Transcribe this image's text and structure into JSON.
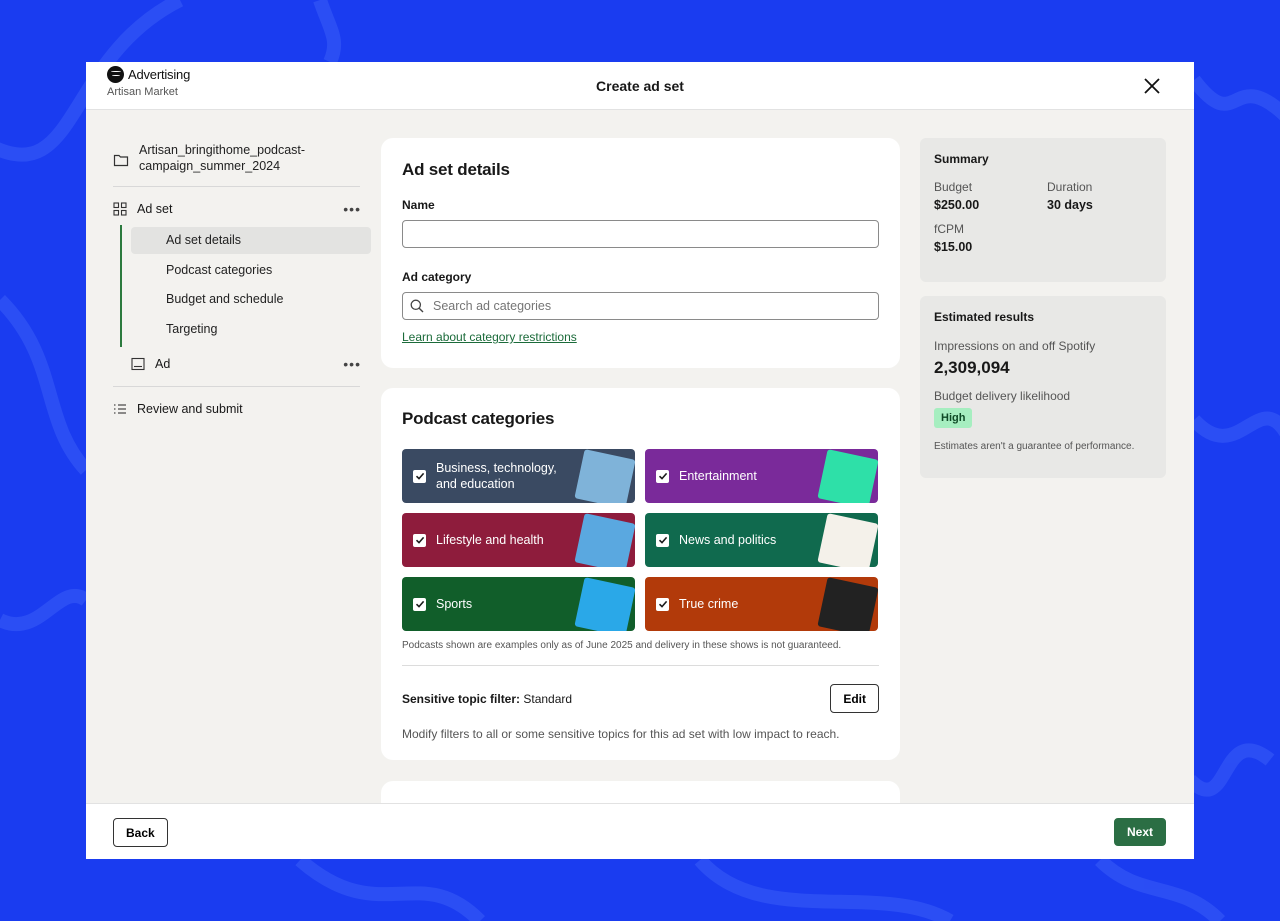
{
  "header": {
    "brand": "Advertising",
    "account": "Artisan Market",
    "title": "Create ad set"
  },
  "sidebar": {
    "campaign": "Artisan_bringithome_podcast-campaign_summer_2024",
    "adset_label": "Ad set",
    "adset_items": [
      "Ad set details",
      "Podcast categories",
      "Budget and schedule",
      "Targeting"
    ],
    "ad_label": "Ad",
    "review_label": "Review and submit"
  },
  "details": {
    "heading": "Ad set details",
    "name_label": "Name",
    "name_value": "",
    "category_label": "Ad category",
    "category_placeholder": "Search ad categories",
    "restrictions_link": "Learn about category restrictions"
  },
  "podcast": {
    "heading": "Podcast categories",
    "categories": [
      {
        "label": "Business, technology, and education",
        "checked": true,
        "color": "#3a4a62"
      },
      {
        "label": "Entertainment",
        "checked": true,
        "color": "#7a2a9a"
      },
      {
        "label": "Lifestyle and health",
        "checked": true,
        "color": "#8e1c3c"
      },
      {
        "label": "News and politics",
        "checked": true,
        "color": "#106a4e"
      },
      {
        "label": "Sports",
        "checked": true,
        "color": "#115e2a"
      },
      {
        "label": "True crime",
        "checked": true,
        "color": "#b23a0a"
      }
    ],
    "note": "Podcasts shown are examples only as of June 2025 and delivery in these shows is not guaranteed.",
    "sensitive_label": "Sensitive topic filter:",
    "sensitive_value": "Standard",
    "edit_label": "Edit",
    "sensitive_desc": "Modify filters to all or some sensitive topics for this ad set with low impact to reach."
  },
  "summary": {
    "title": "Summary",
    "budget_label": "Budget",
    "budget_value": "$250.00",
    "duration_label": "Duration",
    "duration_value": "30 days",
    "fcpm_label": "fCPM",
    "fcpm_value": "$15.00"
  },
  "estimates": {
    "title": "Estimated results",
    "impressions_label": "Impressions on and off Spotify",
    "impressions_value": "2,309,094",
    "likelihood_label": "Budget delivery likelihood",
    "likelihood_value": "High",
    "disclaimer": "Estimates aren't a guarantee of performance."
  },
  "footer": {
    "back_label": "Back",
    "next_label": "Next"
  },
  "colors": {
    "background": "#1a3cf0",
    "accent_green": "#2b6e44",
    "badge_green": "#a6eec0"
  }
}
